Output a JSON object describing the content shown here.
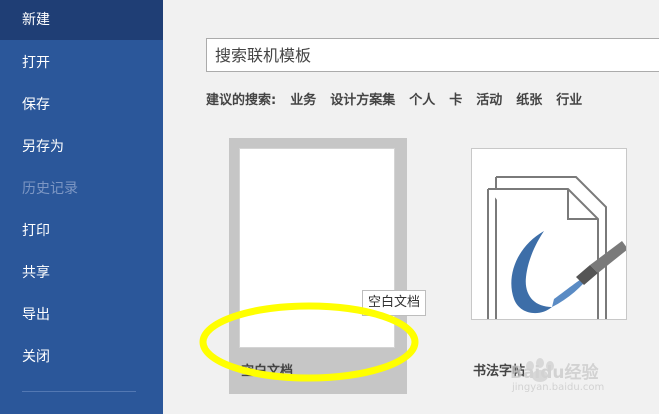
{
  "sidebar": {
    "items": [
      {
        "label": "新建",
        "state": "active"
      },
      {
        "label": "打开",
        "state": "normal"
      },
      {
        "label": "保存",
        "state": "normal"
      },
      {
        "label": "另存为",
        "state": "normal"
      },
      {
        "label": "历史记录",
        "state": "disabled"
      },
      {
        "label": "打印",
        "state": "normal"
      },
      {
        "label": "共享",
        "state": "normal"
      },
      {
        "label": "导出",
        "state": "normal"
      },
      {
        "label": "关闭",
        "state": "normal"
      }
    ],
    "colors": {
      "background": "#2b579a",
      "active": "#1f3e75"
    }
  },
  "search": {
    "placeholder": "搜索联机模板"
  },
  "suggestions": {
    "label": "建议的搜索:",
    "links": [
      "业务",
      "设计方案集",
      "个人",
      "卡",
      "活动",
      "纸张",
      "行业"
    ]
  },
  "templates": [
    {
      "label": "空白文档",
      "selected": true
    },
    {
      "label": "书法字帖",
      "selected": false
    }
  ],
  "tooltip": {
    "text": "空白文档"
  },
  "annotation": {
    "color": "#ffff00"
  },
  "watermark": {
    "text": "Baidu经验",
    "subtext": "jingyan.baidu.com"
  }
}
